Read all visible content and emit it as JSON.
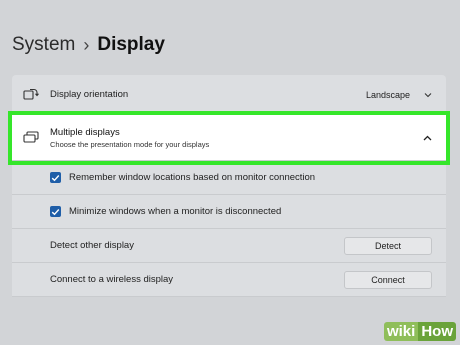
{
  "breadcrumb": {
    "parent": "System",
    "separator": "›",
    "current": "Display"
  },
  "orientation": {
    "label": "Display orientation",
    "value": "Landscape",
    "icon": "rotate-display-icon"
  },
  "multiple_displays": {
    "title": "Multiple displays",
    "subtitle": "Choose the presentation mode for your displays",
    "icon": "multiple-displays-icon",
    "expanded": true
  },
  "options": {
    "remember_windows": {
      "label": "Remember window locations based on monitor connection",
      "checked": true
    },
    "minimize_windows": {
      "label": "Minimize windows when a monitor is disconnected",
      "checked": true
    }
  },
  "detect": {
    "label": "Detect other display",
    "button": "Detect"
  },
  "wireless": {
    "label": "Connect to a wireless display",
    "button": "Connect"
  },
  "watermark": {
    "part1": "wiki",
    "part2": "How"
  },
  "colors": {
    "highlight": "#35e62a",
    "checkbox": "#1f5ea8",
    "background": "#d2d4d7"
  }
}
